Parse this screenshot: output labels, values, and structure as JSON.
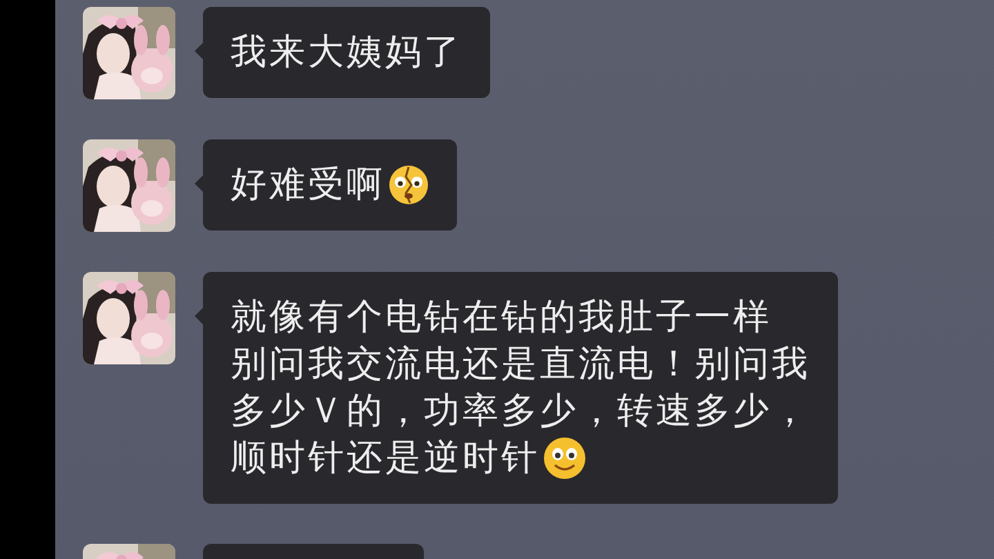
{
  "messages": [
    {
      "kind": "plain",
      "lines": [
        "我来大姨妈了"
      ]
    },
    {
      "kind": "cracked-face",
      "lines": [
        "好难受啊"
      ]
    },
    {
      "kind": "smile",
      "lines": [
        "就像有个电钻在钻的我肚子一样",
        "别问我交流电还是直流电！别问我",
        "多少Ｖ的，功率多少，转速多少，",
        "顺时针还是逆时针"
      ]
    },
    {
      "kind": "blank"
    }
  ]
}
